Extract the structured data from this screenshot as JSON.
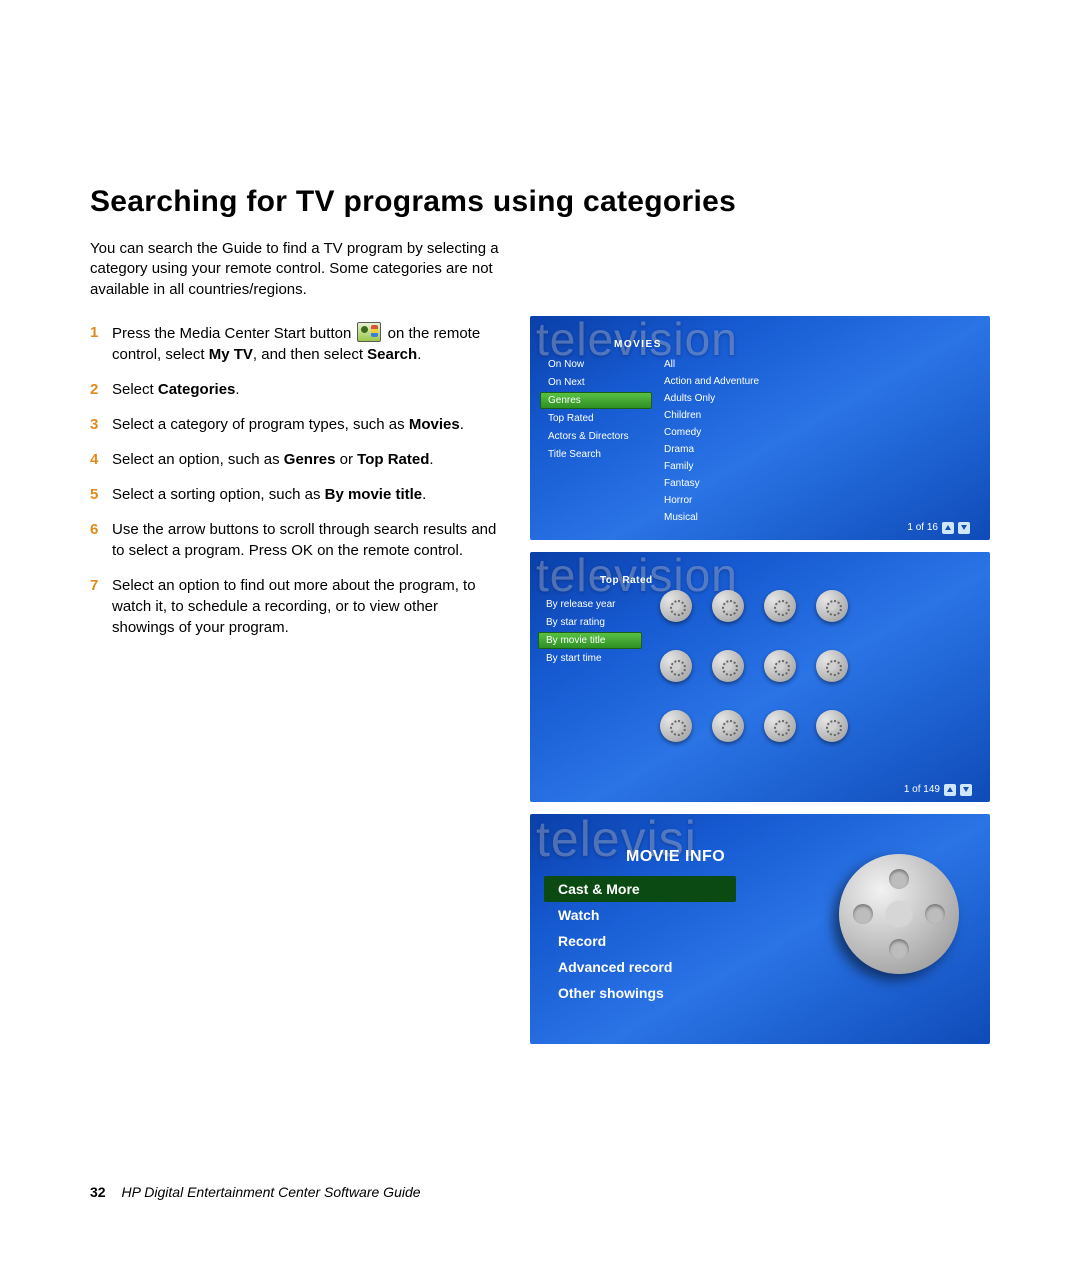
{
  "heading": "Searching for TV programs using categories",
  "intro": "You can search the Guide to find a TV program by selecting a category using your remote control. Some categories are not available in all countries/regions.",
  "steps": {
    "s1a": "Press the Media Center Start button",
    "s1b": "on the remote control, select ",
    "s1c": "My TV",
    "s1d": ", and then select ",
    "s1e": "Search",
    "s2a": "Select ",
    "s2b": "Categories",
    "s3a": "Select a category of program types, such as ",
    "s3b": "Movies",
    "s4a": "Select an option, such as ",
    "s4b": "Genres",
    "s4c": " or ",
    "s4d": "Top Rated",
    "s5a": "Select a sorting option, such as ",
    "s5b": "By movie title",
    "s6": "Use the arrow buttons to scroll through search results and to select a program. Press OK on the remote control.",
    "s7": "Select an option to find out more about the program, to watch it, to schedule a recording, or to view other showings of your program."
  },
  "nums": {
    "n1": "1",
    "n2": "2",
    "n3": "3",
    "n4": "4",
    "n5": "5",
    "n6": "6",
    "n7": "7"
  },
  "panel1": {
    "ghost": "television",
    "header": "MOVIES",
    "left": [
      "On Now",
      "On Next",
      "Genres",
      "Top Rated",
      "Actors & Directors",
      "Title Search"
    ],
    "right": [
      "All",
      "Action and Adventure",
      "Adults Only",
      "Children",
      "Comedy",
      "Drama",
      "Family",
      "Fantasy",
      "Horror",
      "Musical"
    ],
    "footer": "1 of 16",
    "selected": "Genres"
  },
  "panel2": {
    "ghost": "television",
    "header": "Top Rated",
    "side": [
      "By release year",
      "By star rating",
      "By movie title",
      "By start time"
    ],
    "selected": "By movie title",
    "footer": "1 of 149"
  },
  "panel3": {
    "ghost": "televisi",
    "header": "MOVIE INFO",
    "menu": [
      "Cast & More",
      "Watch",
      "Record",
      "Advanced record",
      "Other showings"
    ],
    "selected": "Cast & More"
  },
  "footer": {
    "page": "32",
    "title": "HP Digital Entertainment Center Software Guide"
  }
}
